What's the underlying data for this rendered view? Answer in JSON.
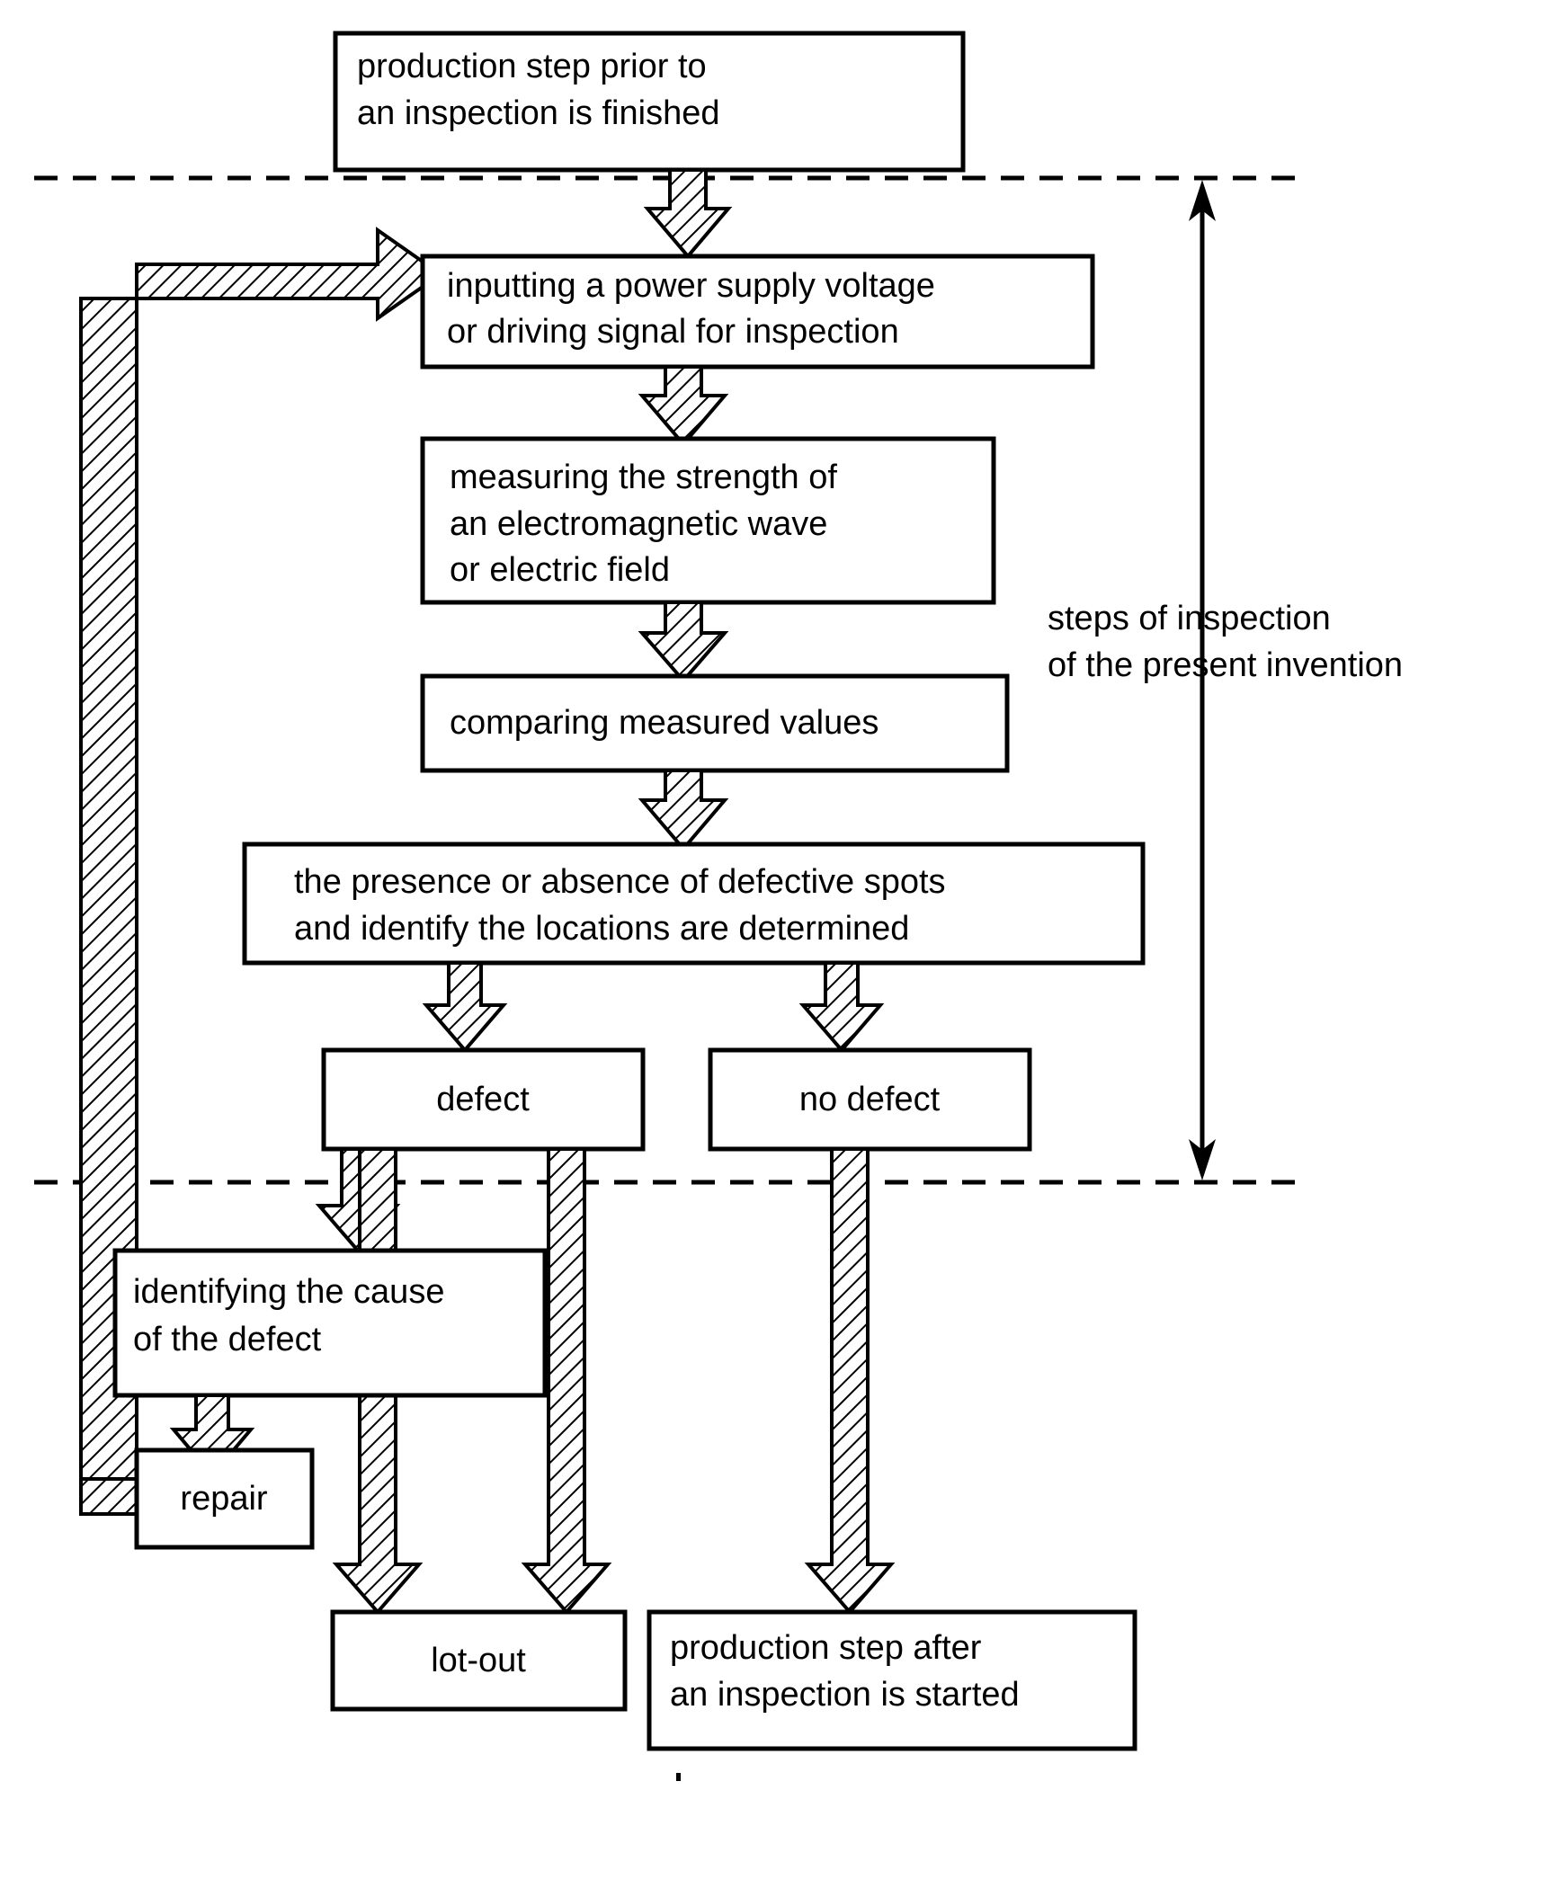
{
  "diagram": {
    "title": "inspection process flowchart",
    "type": "flowchart",
    "background_color": "#ffffff",
    "line_color": "#000000",
    "arrow_fill": "hatched",
    "nodes": [
      {
        "id": "prior_step",
        "lines": [
          "production step prior to",
          "an inspection is finished"
        ],
        "align": "left"
      },
      {
        "id": "inputting",
        "lines": [
          "inputting a power supply voltage",
          "or driving signal for inspection"
        ],
        "align": "left"
      },
      {
        "id": "measuring",
        "lines": [
          "measuring the strength of",
          "an electromagnetic wave",
          "or electric field"
        ],
        "align": "left"
      },
      {
        "id": "comparing",
        "lines": [
          "comparing measured values"
        ],
        "align": "left"
      },
      {
        "id": "presence",
        "lines": [
          "the presence or absence of defective spots",
          "and identify the locations are determined"
        ],
        "align": "left"
      },
      {
        "id": "defect",
        "lines": [
          "defect"
        ],
        "align": "center"
      },
      {
        "id": "no_defect",
        "lines": [
          "no defect"
        ],
        "align": "center"
      },
      {
        "id": "identify_cause",
        "lines": [
          "identifying the cause",
          " of the defect"
        ],
        "align": "left"
      },
      {
        "id": "repair",
        "lines": [
          "repair"
        ],
        "align": "center"
      },
      {
        "id": "lot_out",
        "lines": [
          "lot-out"
        ],
        "align": "center"
      },
      {
        "id": "after_step",
        "lines": [
          "production step after",
          "an inspection is started"
        ],
        "align": "left"
      }
    ],
    "annotations": [
      {
        "id": "scope_label",
        "lines": [
          "steps of inspection",
          "of the present invention"
        ]
      }
    ]
  }
}
